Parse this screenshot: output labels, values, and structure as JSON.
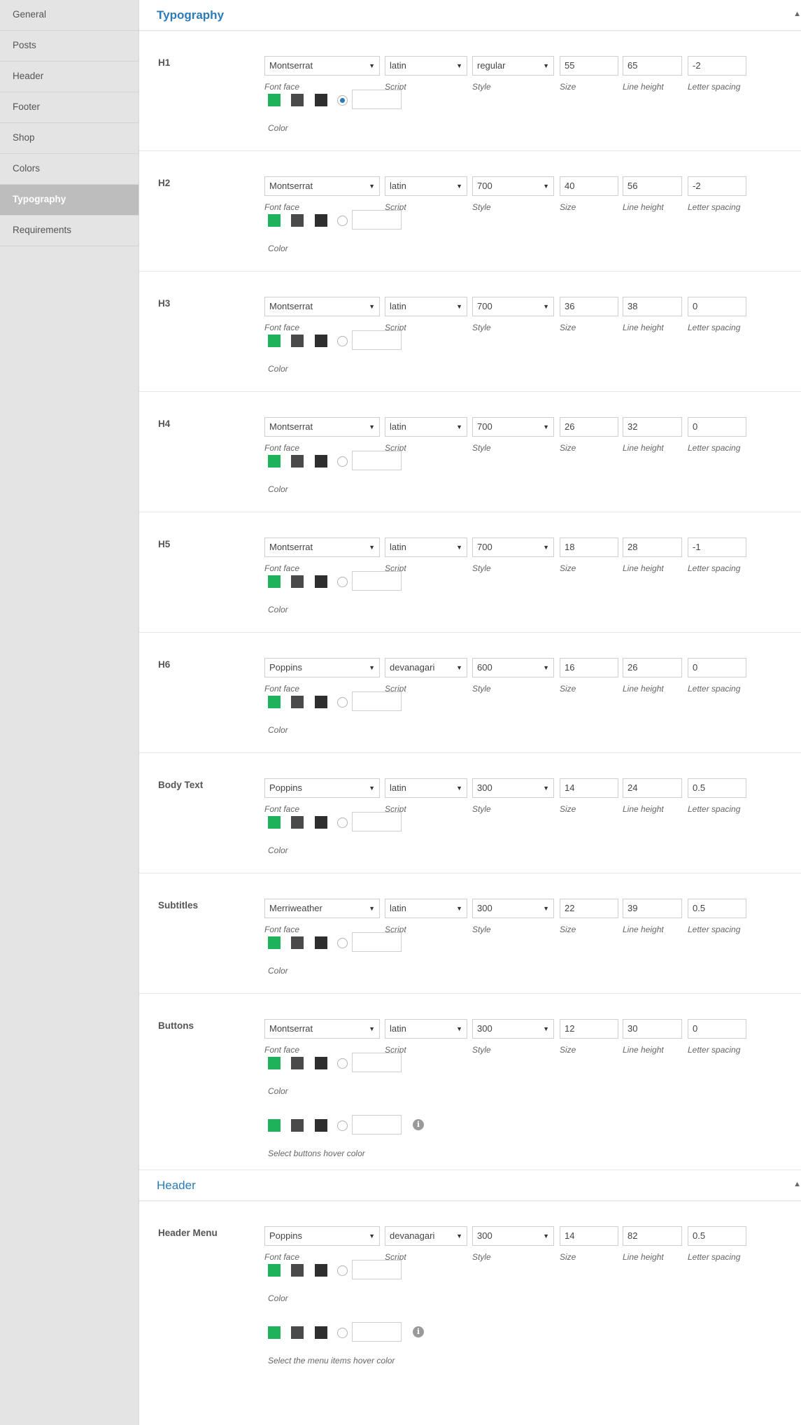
{
  "sidebar": {
    "items": [
      {
        "label": "General",
        "active": false
      },
      {
        "label": "Posts",
        "active": false
      },
      {
        "label": "Header",
        "active": false
      },
      {
        "label": "Footer",
        "active": false
      },
      {
        "label": "Shop",
        "active": false
      },
      {
        "label": "Colors",
        "active": false
      },
      {
        "label": "Typography",
        "active": true
      },
      {
        "label": "Requirements",
        "active": false
      }
    ]
  },
  "captions": {
    "font_face": "Font face",
    "script": "Script",
    "style": "Style",
    "size": "Size",
    "line_height": "Line height",
    "letter_spacing": "Letter spacing",
    "color": "Color"
  },
  "icons": {
    "collapse": "triangle-up-icon",
    "info": "info-icon",
    "dropdown": "caret-down-icon"
  },
  "swatch_colors": [
    "#1db35a",
    "#4a4a4a",
    "#2e2e2e"
  ],
  "accent_color": "#2b7bb9",
  "typography": {
    "title": "Typography",
    "rows": [
      {
        "label": "H1",
        "font": "Montserrat",
        "script": "latin",
        "style": "regular",
        "size": "55",
        "line_height": "65",
        "letter_spacing": "-2"
      },
      {
        "label": "H2",
        "font": "Montserrat",
        "script": "latin",
        "style": "700",
        "size": "40",
        "line_height": "56",
        "letter_spacing": "-2"
      },
      {
        "label": "H3",
        "font": "Montserrat",
        "script": "latin",
        "style": "700",
        "size": "36",
        "line_height": "38",
        "letter_spacing": "0"
      },
      {
        "label": "H4",
        "font": "Montserrat",
        "script": "latin",
        "style": "700",
        "size": "26",
        "line_height": "32",
        "letter_spacing": "0"
      },
      {
        "label": "H5",
        "font": "Montserrat",
        "script": "latin",
        "style": "700",
        "size": "18",
        "line_height": "28",
        "letter_spacing": "-1"
      },
      {
        "label": "H6",
        "font": "Poppins",
        "script": "devanagari",
        "style": "600",
        "size": "16",
        "line_height": "26",
        "letter_spacing": "0"
      },
      {
        "label": "Body Text",
        "font": "Poppins",
        "script": "latin",
        "style": "300",
        "size": "14",
        "line_height": "24",
        "letter_spacing": "0.5"
      },
      {
        "label": "Subtitles",
        "font": "Merriweather",
        "script": "latin",
        "style": "300",
        "size": "22",
        "line_height": "39",
        "letter_spacing": "0.5"
      },
      {
        "label": "Buttons",
        "font": "Montserrat",
        "script": "latin",
        "style": "300",
        "size": "12",
        "line_height": "30",
        "letter_spacing": "0",
        "hover_caption": "Select buttons hover color"
      }
    ]
  },
  "header_section": {
    "title": "Header",
    "rows": [
      {
        "label": "Header Menu",
        "font": "Poppins",
        "script": "devanagari",
        "style": "300",
        "size": "14",
        "line_height": "82",
        "letter_spacing": "0.5",
        "hover_caption": "Select the menu items hover color"
      }
    ]
  }
}
